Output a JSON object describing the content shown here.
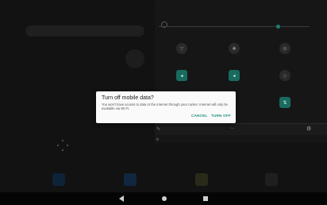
{
  "dialog": {
    "title": "Turn off mobile data?",
    "message": "You won't have access to data or the internet through your carrier. Internet will only be available via Wi-Fi.",
    "cancel_label": "CANCEL",
    "confirm_label": "TURN OFF"
  },
  "accent_color": "#1a8f7e"
}
